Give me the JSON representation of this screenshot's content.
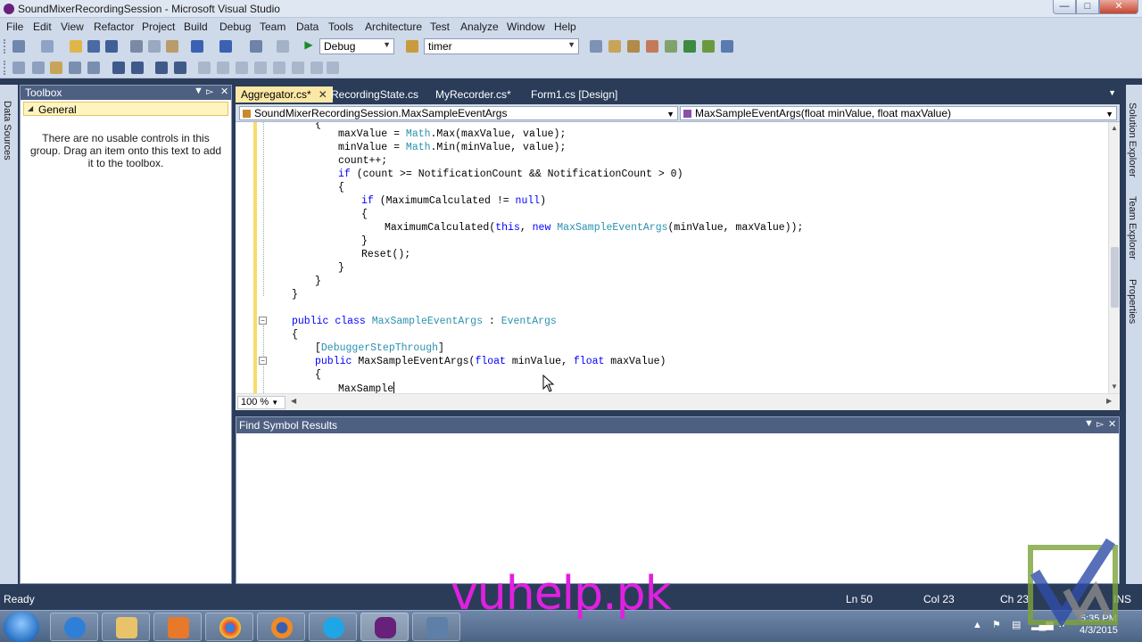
{
  "window": {
    "title": "SoundMixerRecordingSession - Microsoft Visual Studio"
  },
  "menu": [
    "File",
    "Edit",
    "View",
    "Refactor",
    "Project",
    "Build",
    "Debug",
    "Team",
    "Data",
    "Tools",
    "Architecture",
    "Test",
    "Analyze",
    "Window",
    "Help"
  ],
  "toolbar": {
    "config": "Debug",
    "find": "timer"
  },
  "left_strip": {
    "label": "Data Sources"
  },
  "toolbox": {
    "title": "Toolbox",
    "group": "General",
    "message": "There are no usable controls in this group. Drag an item onto this text to add it to the toolbox."
  },
  "tabs": [
    {
      "label": "Aggregator.cs*",
      "active": true
    },
    {
      "label": "RecordingState.cs"
    },
    {
      "label": "MyRecorder.cs*"
    },
    {
      "label": "Form1.cs [Design]"
    }
  ],
  "navbar": {
    "type_combo": "SoundMixerRecordingSession.MaxSampleEventArgs",
    "member_combo": "MaxSampleEventArgs(float minValue, float maxValue)"
  },
  "code": {
    "line1": "{",
    "line2a": "maxValue = ",
    "line2b": "Math",
    "line2c": ".Max(maxValue, value);",
    "line3a": "minValue = ",
    "line3b": "Math",
    "line3c": ".Min(minValue, value);",
    "line4": "count++;",
    "line5a": "if",
    "line5b": " (count >= NotificationCount && NotificationCount > 0)",
    "line6": "{",
    "line7a": "if",
    "line7b": " (MaximumCalculated != ",
    "line7c": "null",
    "line7d": ")",
    "line8": "{",
    "line9a": "MaximumCalculated(",
    "line9b": "this",
    "line9c": ", ",
    "line9d": "new",
    "line9e": " ",
    "line9f": "MaxSampleEventArgs",
    "line9g": "(minValue, maxValue));",
    "line10": "}",
    "line11": "Reset();",
    "line12": "}",
    "line13": "}",
    "line14": "}",
    "line16a": "public",
    "line16b": " ",
    "line16c": "class",
    "line16d": " ",
    "line16e": "MaxSampleEventArgs",
    "line16f": " : ",
    "line16g": "EventArgs",
    "line17": "{",
    "line18a": "[",
    "line18b": "DebuggerStepThrough",
    "line18c": "]",
    "line19a": "public",
    "line19b": " MaxSampleEventArgs(",
    "line19c": "float",
    "line19d": " minValue, ",
    "line19e": "float",
    "line19f": " maxValue)",
    "line20": "{",
    "line21": "MaxSample"
  },
  "zoom": "100 %",
  "find_panel": {
    "title": "Find Symbol Results"
  },
  "right_strip": {
    "labels": [
      "Solution Explorer",
      "Team Explorer",
      "Properties"
    ]
  },
  "status": {
    "ready": "Ready",
    "line": "Ln 50",
    "col": "Col 23",
    "ch": "Ch 23",
    "ins": "INS"
  },
  "watermark": "vuhelp.pk",
  "clock": {
    "time": "5:35 PM",
    "date": "4/3/2015"
  }
}
